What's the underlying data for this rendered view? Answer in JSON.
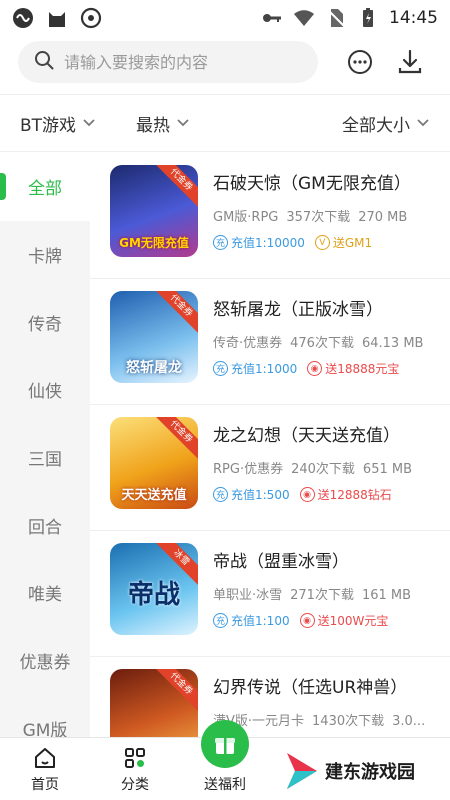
{
  "status_bar": {
    "time": "14:45"
  },
  "search": {
    "placeholder": "请输入要搜索的内容"
  },
  "filters": {
    "category": "BT游戏",
    "sort": "最热",
    "size": "全部大小"
  },
  "sidebar": {
    "items": [
      {
        "label": "全部",
        "active": true
      },
      {
        "label": "卡牌"
      },
      {
        "label": "传奇"
      },
      {
        "label": "仙侠"
      },
      {
        "label": "三国"
      },
      {
        "label": "回合"
      },
      {
        "label": "唯美"
      },
      {
        "label": "优惠券"
      },
      {
        "label": "GM版"
      }
    ]
  },
  "games": [
    {
      "name": "石破天惊（GM无限充值）",
      "genre": "GM版·RPG",
      "downloads": "357次下载",
      "size": "270 MB",
      "tag1": "充值1:10000",
      "tag2": "送GM1",
      "tag2_color": "gold",
      "thumb_ribbon": "代金券",
      "thumb_text": "GM无限充值",
      "thumb_bg": "#3a4bb0"
    },
    {
      "name": "怒斩屠龙（正版冰雪）",
      "genre": "传奇·优惠券",
      "downloads": "476次下载",
      "size": "64.13 MB",
      "tag1": "充值1:1000",
      "tag2": "送18888元宝",
      "tag2_color": "red",
      "thumb_ribbon": "代金券",
      "thumb_text": "怒斩屠龙",
      "thumb_bg": "#4f8fd8"
    },
    {
      "name": "龙之幻想（天天送充值）",
      "genre": "RPG·优惠券",
      "downloads": "240次下载",
      "size": "651 MB",
      "tag1": "充值1:500",
      "tag2": "送12888钻石",
      "tag2_color": "red",
      "thumb_ribbon": "代金券",
      "thumb_text": "天天送充值",
      "thumb_bg": "#e9a21a"
    },
    {
      "name": "帝战（盟重冰雪）",
      "genre": "单职业·冰雪",
      "downloads": "271次下载",
      "size": "161 MB",
      "tag1": "充值1:100",
      "tag2": "送100W元宝",
      "tag2_color": "red",
      "thumb_ribbon": "冰雪",
      "thumb_text": "帝战",
      "thumb_bg": "#3aa6d8"
    },
    {
      "name": "幻界传说（任选UR神兽）",
      "genre": "满V版·一元月卡",
      "downloads": "1430次下载",
      "size": "3.0...",
      "tag1": "",
      "tag2": "",
      "tag2_color": "red",
      "thumb_ribbon": "代金券",
      "thumb_text": "",
      "thumb_bg": "#a03a1e"
    }
  ],
  "bottom_nav": {
    "home": "首页",
    "category": "分类",
    "welfare": "送福利"
  },
  "watermark": {
    "text": "建东游戏园"
  },
  "colors": {
    "accent": "#2bbd4a",
    "tag_blue": "#3b9ae0",
    "tag_red": "#ea4b4b",
    "tag_gold": "#e0a11a"
  }
}
